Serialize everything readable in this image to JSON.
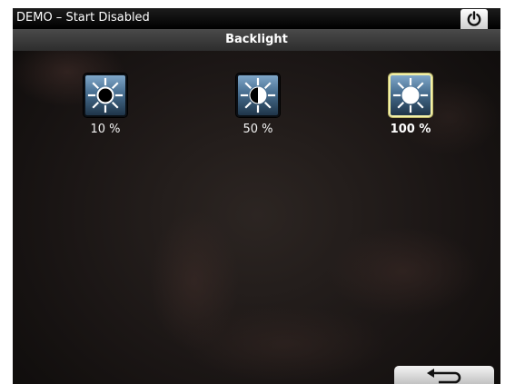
{
  "header": {
    "title": "DEMO – Start Disabled",
    "power_icon": "power-icon"
  },
  "screen": {
    "title": "Backlight"
  },
  "backlight": {
    "options": [
      {
        "label": "10 %",
        "level": 10,
        "icon": "brightness-low-icon",
        "selected": false
      },
      {
        "label": "50 %",
        "level": 50,
        "icon": "brightness-medium-icon",
        "selected": false
      },
      {
        "label": "100 %",
        "level": 100,
        "icon": "brightness-high-icon",
        "selected": true
      }
    ]
  },
  "footer": {
    "back_icon": "return-arrow-icon"
  },
  "colors": {
    "icon_gradient_top": "#7fa7c9",
    "icon_gradient_bottom": "#1f3549",
    "selected_border": "#f3f0a8"
  }
}
